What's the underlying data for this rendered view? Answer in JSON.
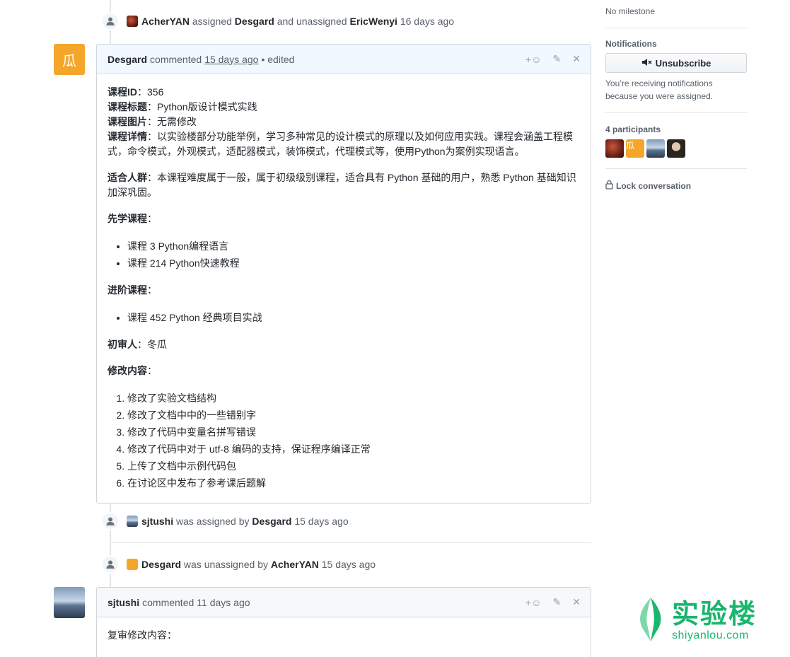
{
  "events": {
    "e1": {
      "actor": "AcherYAN",
      "verb1": "assigned",
      "target1": "Desgard",
      "verb2": "and unassigned",
      "target2": "EricWenyi",
      "time": "16 days ago"
    },
    "e2": {
      "actor": "sjtushi",
      "verb": "was assigned by",
      "target": "Desgard",
      "time": "15 days ago"
    },
    "e3": {
      "actor": "Desgard",
      "verb": "was unassigned by",
      "target": "AcherYAN",
      "time": "15 days ago"
    }
  },
  "comment1": {
    "author": "Desgard",
    "action": "commented",
    "time": "15 days ago",
    "edited": "• edited",
    "avatar_glyph": "瓜",
    "lines": {
      "id_label": "课程ID",
      "id_value": "：356",
      "title_label": "课程标题",
      "title_value": "：Python版设计模式实践",
      "image_label": "课程图片",
      "image_value": "：无需修改",
      "detail_label": "课程详情",
      "detail_value": "：以实验楼部分功能举例，学习多种常见的设计模式的原理以及如何应用实践。课程会涵盖工程模式，命令模式，外观模式，适配器模式，装饰模式，代理模式等，使用Python为案例实现语言。",
      "audience_label": "适合人群",
      "audience_value": "：本课程难度属于一般，属于初级级别课程，适合具有 Python 基础的用户，熟悉 Python 基础知识加深巩固。",
      "prereq_label": "先学课程",
      "prereq_colon": "：",
      "prereq": [
        "课程 3 Python编程语言",
        "课程 214 Python快速教程"
      ],
      "advanced_label": "进阶课程",
      "advanced_colon": "：",
      "advanced": [
        "课程 452 Python 经典项目实战"
      ],
      "reviewer_label": "初审人",
      "reviewer_value": "：冬瓜",
      "changes_label": "修改内容",
      "changes_colon": "：",
      "changes": [
        "修改了实验文档结构",
        "修改了文档中中的一些错别字",
        "修改了代码中变量名拼写错误",
        "修改了代码中对于 utf-8 编码的支持，保证程序编译正常",
        "上传了文档中示例代码包",
        "在讨论区中发布了参考课后题解"
      ]
    }
  },
  "comment2": {
    "author": "sjtushi",
    "action": "commented",
    "time": "11 days ago",
    "body_first": "复审修改内容："
  },
  "actions": {
    "reaction": "+☺",
    "edit": "✎",
    "close": "✕"
  },
  "sidebar": {
    "milestone": "No milestone",
    "notifications_heading": "Notifications",
    "unsubscribe_label": "Unsubscribe",
    "notification_reason": "You’re receiving notifications because you were assigned.",
    "participants_heading": "4 participants",
    "lock_label": "Lock conversation"
  },
  "watermark": {
    "cn": "实验楼",
    "en": "shiyanlou.com"
  },
  "colors": {
    "accent_orange": "#f4a62a",
    "brand_green": "#1bb56e"
  }
}
